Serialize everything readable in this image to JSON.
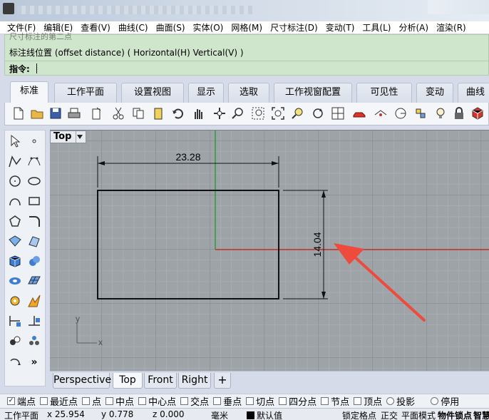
{
  "menu": [
    "文件(F)",
    "编辑(E)",
    "查看(V)",
    "曲线(C)",
    "曲面(S)",
    "实体(O)",
    "网格(M)",
    "尺寸标注(D)",
    "变动(T)",
    "工具(L)",
    "分析(A)",
    "渲染(R)"
  ],
  "command": {
    "previous": "尺寸标注的第二点",
    "line": "标注线位置 (offset distance) ( Horizontal(H)  Vertical(V) )",
    "prompt": "指令:",
    "input_value": ""
  },
  "tabs": [
    "标准",
    "工作平面",
    "设置视图",
    "显示",
    "选取",
    "工作视窗配置",
    "可见性",
    "变动",
    "曲线"
  ],
  "active_tab": "标准",
  "toolbar_icons": [
    "new-file-icon",
    "open-folder-icon",
    "save-icon",
    "print-icon",
    "import-icon",
    "cut-icon",
    "copy-icon",
    "paste-icon",
    "undo-icon",
    "pan-hand-icon",
    "rotate-view-icon",
    "zoom-icon",
    "zoom-window-icon",
    "zoom-extents-icon",
    "zoom-selected-icon",
    "rotate-icon",
    "four-viewports-icon",
    "car-icon",
    "eye-camera-icon",
    "circle-icon",
    "named-view-icon",
    "bulb-icon",
    "lock-icon",
    "render-icon"
  ],
  "palette_icons": [
    "select-arrow-icon",
    "point-icon",
    "polyline-icon",
    "curve-points-icon",
    "circle-icon",
    "ellipse-icon",
    "arc-icon",
    "rectangle-icon",
    "polygon-icon",
    "fillet-icon",
    "surface-points-icon",
    "surface-icon",
    "box-solid-icon",
    "sphere-solid-icon",
    "mesh-icon",
    "surface-grid-icon",
    "transform-gear-icon",
    "boolean-icon",
    "dimension-icon",
    "dimension2-icon",
    "group-icon",
    "points-icon",
    "rotate-arrow-icon",
    "more-icon"
  ],
  "viewport": {
    "name": "Top",
    "dimension_horizontal": "23.28",
    "dimension_vertical": "14.04",
    "axis_x": "x",
    "axis_y": "y"
  },
  "viewport_tabs": [
    "Perspective",
    "Top",
    "Front",
    "Right"
  ],
  "active_viewport_tab": "Top",
  "add_viewport_glyph": "+",
  "osnaps": [
    {
      "label": "端点",
      "checked": true
    },
    {
      "label": "最近点",
      "checked": false
    },
    {
      "label": "点",
      "checked": false
    },
    {
      "label": "中点",
      "checked": false
    },
    {
      "label": "中心点",
      "checked": false
    },
    {
      "label": "交点",
      "checked": false
    },
    {
      "label": "垂点",
      "checked": false
    },
    {
      "label": "切点",
      "checked": false
    },
    {
      "label": "四分点",
      "checked": false
    },
    {
      "label": "节点",
      "checked": false
    },
    {
      "label": "顶点",
      "checked": false
    },
    {
      "label": "投影",
      "checked": false
    },
    {
      "label": "停用",
      "checked": false
    }
  ],
  "status": {
    "cplane": "工作平面",
    "x": "x 25.954",
    "y": "y 0.778",
    "z": "z 0.000",
    "units": "毫米",
    "layer": "默认值",
    "grid_snap": "锁定格点",
    "ortho": "正交",
    "planar": "平面模式",
    "osnap": "物件锁点",
    "smart": "智慧"
  },
  "colors": {
    "command_bg": "#cfe6cc",
    "x_axis": "#c0312b",
    "y_axis": "#2e9a3a",
    "arrow": "#ee4b3c",
    "grid_bg": "#9ea3a8"
  }
}
